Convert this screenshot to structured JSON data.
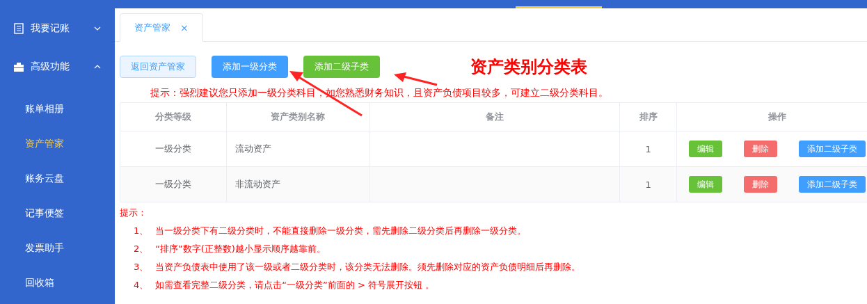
{
  "sidebar": {
    "groups": [
      {
        "label": "我要记账",
        "expanded": false
      },
      {
        "label": "高级功能",
        "expanded": true,
        "children": [
          {
            "label": "账单相册",
            "selected": false
          },
          {
            "label": "资产管家",
            "selected": true
          },
          {
            "label": "账务云盘",
            "selected": false
          },
          {
            "label": "记事便签",
            "selected": false
          },
          {
            "label": "发票助手",
            "selected": false
          },
          {
            "label": "回收箱",
            "selected": false
          }
        ]
      }
    ]
  },
  "tabs": [
    {
      "label": "资产管家",
      "close": "×",
      "selected": true
    }
  ],
  "toolbar": {
    "buttons": [
      {
        "label": "返回资产管家",
        "kind": "plain"
      },
      {
        "label": "添加一级分类",
        "kind": "primary"
      },
      {
        "label": "添加二级子类",
        "kind": "success"
      }
    ],
    "title": "资产类别分类表"
  },
  "hint": "提示：强烈建议您只添加一级分类科目，如您熟悉财务知识，且资产负债项目较多，可建立二级分类科目。",
  "table": {
    "columns": [
      "分类等级",
      "资产类别名称",
      "备注",
      "排序",
      "操作"
    ],
    "rows": [
      {
        "level": "一级分类",
        "name": "流动资产",
        "note": "",
        "order": "1",
        "actions": [
          {
            "label": "编辑",
            "kind": "edit"
          },
          {
            "label": "删除",
            "kind": "delete"
          },
          {
            "label": "添加二级子类",
            "kind": "add"
          }
        ]
      },
      {
        "level": "一级分类",
        "name": "非流动资产",
        "note": "",
        "order": "1",
        "actions": [
          {
            "label": "编辑",
            "kind": "edit"
          },
          {
            "label": "删除",
            "kind": "delete"
          },
          {
            "label": "添加二级子类",
            "kind": "add"
          }
        ]
      }
    ]
  },
  "notes": {
    "title": "提示：",
    "items": [
      {
        "number": "1、",
        "text": "当一级分类下有二级分类时，不能直接删除一级分类，需先删除二级分类后再删除一级分类。"
      },
      {
        "number": "2、",
        "text": "“排序”数字(正整数)越小显示顺序越靠前。"
      },
      {
        "number": "3、",
        "text": "当资产负债表中使用了该一级或者二级分类时，该分类无法删除。须先删除对应的资产负债明细后再删除。"
      },
      {
        "number": "4、",
        "text": "如需查看完整二级分类，请点击“一级分类”前面的 > 符号展开按钮 。"
      }
    ]
  }
}
